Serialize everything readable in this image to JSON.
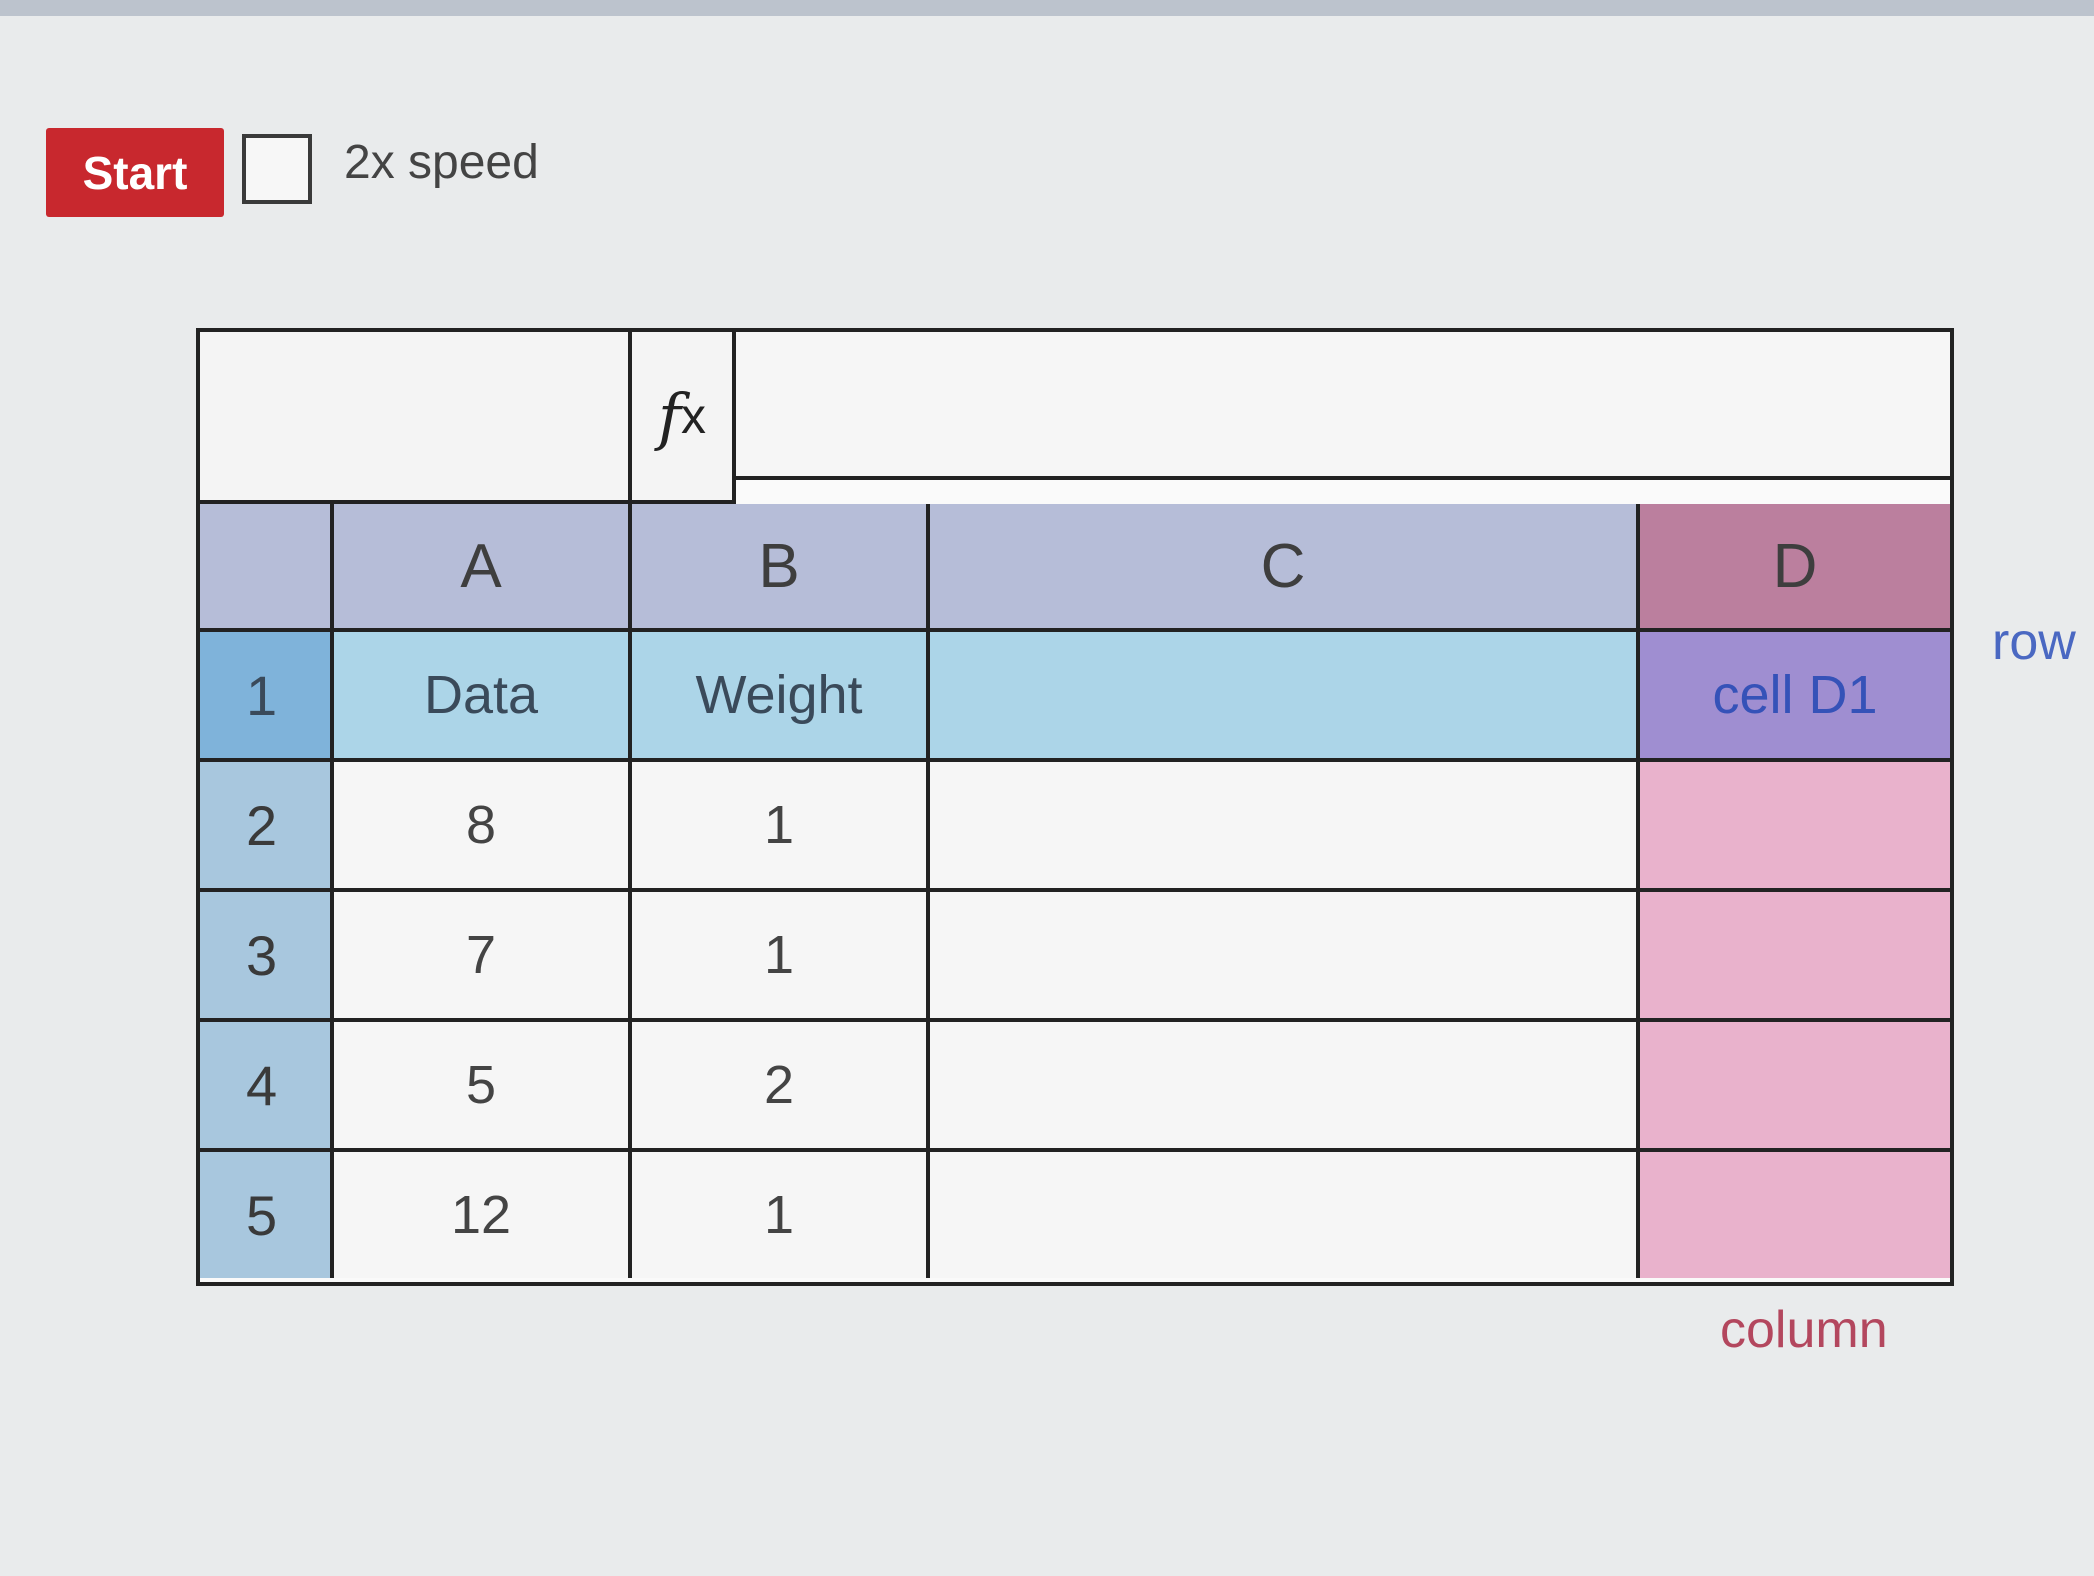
{
  "controls": {
    "start_label": "Start",
    "speed_checkbox_checked": false,
    "speed_label": "2x speed"
  },
  "formula_bar": {
    "fx_symbol": "f",
    "fx_sub": "x",
    "name_box_value": "",
    "formula_value": ""
  },
  "sheet": {
    "columns": [
      "A",
      "B",
      "C",
      "D"
    ],
    "rows": [
      {
        "num": "1",
        "cells": [
          "Data",
          "Weight",
          "",
          "cell D1"
        ]
      },
      {
        "num": "2",
        "cells": [
          "8",
          "1",
          "",
          ""
        ]
      },
      {
        "num": "3",
        "cells": [
          "7",
          "1",
          "",
          ""
        ]
      },
      {
        "num": "4",
        "cells": [
          "5",
          "2",
          "",
          ""
        ]
      },
      {
        "num": "5",
        "cells": [
          "12",
          "1",
          "",
          ""
        ]
      }
    ]
  },
  "annotations": {
    "row_label": "row",
    "column_label": "column"
  },
  "colors": {
    "start_button": "#c8282e",
    "column_header": "#b6bdd8",
    "row_highlight": "#acd5e8",
    "column_highlight": "#e9b2cc",
    "selected_cell": "#9f8ed1",
    "row_label_color": "#4a68c2",
    "column_label_color": "#b3475e"
  }
}
